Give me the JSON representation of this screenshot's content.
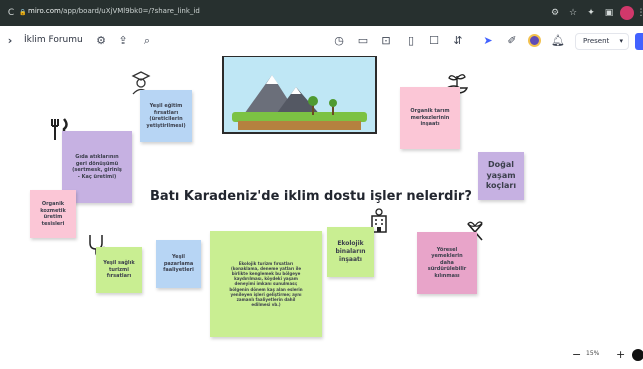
{
  "browser": {
    "reload_glyph": "C",
    "url_host": "miro.com",
    "url_path": "/app/board/uXjVMl9bk0=/?share_link_id"
  },
  "toolbar": {
    "board_title": "İklim Forumu",
    "present_label": "Present",
    "present_chevron": "▾"
  },
  "board": {
    "headline": "Batı Karadeniz'de iklim dostu işler nelerdir?",
    "stickies": {
      "yesil_egitim": [
        "Yeşil eğitim",
        "fırsatları",
        "(üreticilerin",
        "yetiştirilmesi)"
      ],
      "gida_atiklari": [
        "Gıda atıklarının",
        "geri dönüşümü",
        "(sertmesk, giriniş",
        "- Kaç üretimi)"
      ],
      "organik_kozmetik": [
        "Organik",
        "kozmetik",
        "üretim",
        "tesisleri"
      ],
      "yesil_saglik": [
        "Yeşil sağlık",
        "turizmi",
        "fırsatları"
      ],
      "yesil_pazarlama": [
        "Yeşil",
        "pazarlama",
        "faaliyetleri"
      ],
      "ekolojik_turizm": [
        "Ekolojik turizm fırsatları",
        "(konaklama, deneme yatları ile",
        "birlikte kenglemek bu bölgeye",
        "kaydırılması, köydeki yaşam",
        "deneyimi imkanı sunulması;",
        "bölgenin dönem kaş alan eslerin",
        "yenileyen işleri geliştirme; aynı",
        "zamanlı faaliyetlerin dahil",
        "edilmesi vb.)"
      ],
      "ekolojik_binalar": [
        "Ekolojik",
        "binaların",
        "inşaatı"
      ],
      "organik_tarim": [
        "Organik tarım",
        "merkezlerinin",
        "inşaatı"
      ],
      "dogal_yasam": [
        "Doğal",
        "yaşam",
        "koçları"
      ],
      "yoresel_yemekler": [
        "Yöresel",
        "yemeklerin",
        "daha",
        "sürdürülebilir",
        "kılınması"
      ]
    }
  },
  "zoom": {
    "minus": "−",
    "value": "15%",
    "plus": "+"
  },
  "colors": {
    "chrome": "#27302f",
    "pink": "#fbc6d6",
    "blue": "#b7d5f4",
    "purple": "#c6b1e2",
    "green": "#c9ee92",
    "magenta": "#e8a4c9",
    "brand": "#4262ff"
  }
}
